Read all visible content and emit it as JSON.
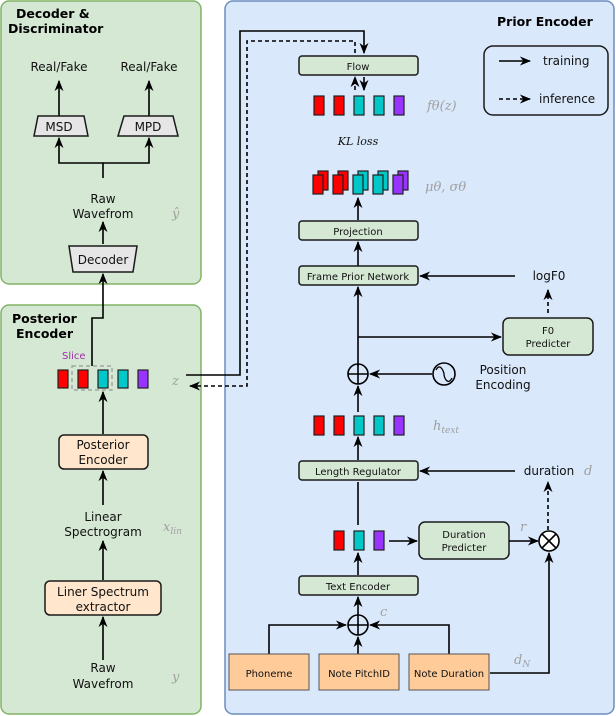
{
  "panels": {
    "decoder_discriminator": {
      "title_line1": "Decoder &",
      "title_line2": "Discriminator"
    },
    "posterior_encoder": {
      "title_line1": "Posterior",
      "title_line2": "Encoder"
    },
    "prior_encoder": {
      "title": "Prior Encoder"
    }
  },
  "decoder": {
    "real_fake_msd": "Real/Fake",
    "real_fake_mpd": "Real/Fake",
    "msd": "MSD",
    "mpd": "MPD",
    "raw_wave_line1": "Raw",
    "raw_wave_line2": "Wavefrom",
    "y_hat": "ŷ",
    "decoder_label": "Decoder"
  },
  "posterior": {
    "slice": "Slice",
    "z": "z",
    "block_line1": "Posterior",
    "block_line2": "Encoder",
    "linear_line1": "Linear",
    "linear_line2": "Spectrogram",
    "x_lin": "x",
    "x_lin_sub": "lin",
    "extractor_line1": "Liner Spectrum",
    "extractor_line2": "extractor",
    "raw_line1": "Raw",
    "raw_line2": "Wavefrom",
    "y": "y"
  },
  "prior": {
    "flow": "Flow",
    "f_theta": "fθ(z)",
    "kl_loss": "KL loss",
    "mu_sigma": "μθ, σθ",
    "projection": "Projection",
    "frame_prior": "Frame Prior Network",
    "logf0": "logF0",
    "f0_line1": "F0",
    "f0_line2": "Predicter",
    "position_line1": "Position",
    "position_line2": "Encoding",
    "h_text": "h",
    "h_text_sub": "text",
    "length_regulator": "Length Regulator",
    "duration": "duration",
    "d": "d",
    "dur_pred_line1": "Duration",
    "dur_pred_line2": "Predicter",
    "r": "r",
    "text_encoder": "Text Encoder",
    "c": "c",
    "phoneme": "Phoneme",
    "note_pitch": "Note PitchID",
    "note_duration": "Note Duration",
    "d_n": "d",
    "d_n_sub": "N"
  },
  "legend": {
    "training": "training",
    "inference": "inference"
  },
  "colors": {
    "red": "#ff0000",
    "cyan": "#00c8c8",
    "purple": "#9933ff",
    "slice_text": "#9b30a8"
  }
}
